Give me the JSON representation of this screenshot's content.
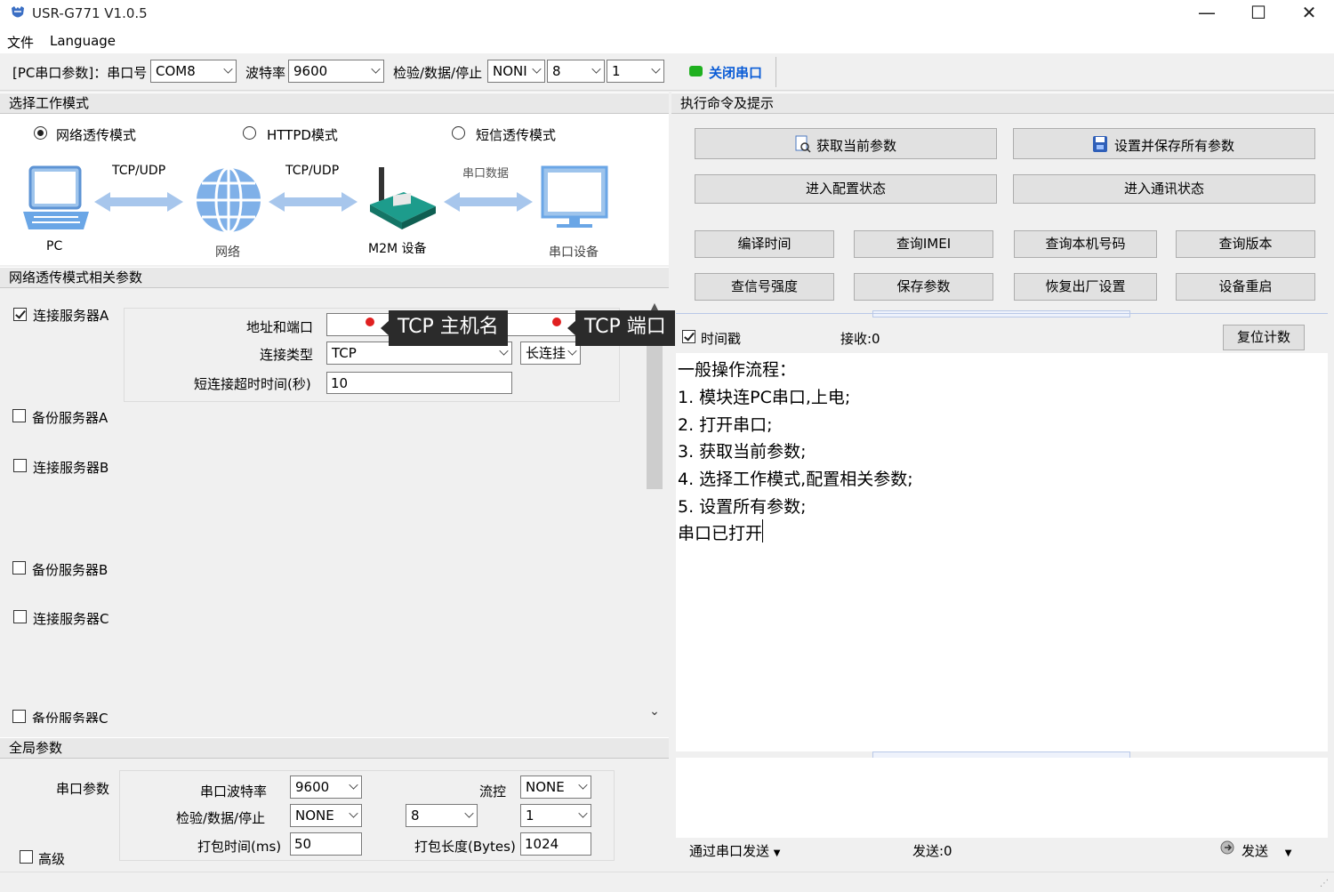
{
  "window": {
    "title": "USR-G771 V1.0.5",
    "minimize": "—",
    "maximize": "☐",
    "close": "✕"
  },
  "menu": {
    "file": "文件",
    "language": "Language"
  },
  "toolbar": {
    "pc_label": "[PC串口参数]：串口号",
    "port": "COM8",
    "baud_label": "波特率",
    "baud": "9600",
    "parity_label": "检验/数据/停止",
    "parity": "NONI",
    "databits": "8",
    "stopbits": "1",
    "close_port": "关闭串口",
    "status_color": "#1fb01f"
  },
  "mode": {
    "header": "选择工作模式",
    "options": [
      "网络透传模式",
      "HTTPD模式",
      "短信透传模式"
    ],
    "selected": "网络透传模式",
    "diagram": {
      "pc": "PC",
      "link1": "TCP/UDP",
      "network": "网络",
      "link2": "TCP/UDP",
      "m2m": "M2M 设备",
      "link3": "串口数据",
      "serial_device": "串口设备"
    }
  },
  "net_params": {
    "header": "网络透传模式相关参数",
    "serverA": {
      "label": "连接服务器A",
      "checked": true,
      "addr_label": "地址和端口",
      "addr_value": "",
      "type_label": "连接类型",
      "type": "TCP",
      "keep": "长连挂",
      "timeout_label": "短连接超时时间(秒)",
      "timeout": "10"
    },
    "servers": [
      "备份服务器A",
      "连接服务器B",
      "备份服务器B",
      "连接服务器C",
      "备份服务器C"
    ]
  },
  "tooltips": {
    "host": "TCP 主机名",
    "port": "TCP 端口"
  },
  "global": {
    "header": "全局参数",
    "serial_label": "串口参数",
    "baud_label": "串口波特率",
    "baud": "9600",
    "flow_label": "流控",
    "flow": "NONE",
    "parity_label": "检验/数据/停止",
    "parity": "NONE",
    "databits": "8",
    "stopbits": "1",
    "pack_time_label": "打包时间(ms)",
    "pack_time": "50",
    "pack_len_label": "打包长度(Bytes)",
    "pack_len": "1024",
    "advanced": "高级"
  },
  "commands": {
    "header": "执行命令及提示",
    "get_params": "获取当前参数",
    "save_all": "设置并保存所有参数",
    "enter_config": "进入配置状态",
    "enter_comm": "进入通讯状态",
    "compile_time": "编译时间",
    "query_imei": "查询IMEI",
    "query_number": "查询本机号码",
    "query_version": "查询版本",
    "query_signal": "查信号强度",
    "save_params": "保存参数",
    "factory_reset": "恢复出厂设置",
    "reboot": "设备重启"
  },
  "log": {
    "timestamp_label": "时间戳",
    "timestamp_checked": true,
    "recv": "接收:0",
    "reset_count": "复位计数",
    "lines": [
      "一般操作流程：",
      "1. 模块连PC串口,上电;",
      "2. 打开串口;",
      "3. 获取当前参数;",
      "4. 选择工作模式,配置相关参数;",
      "5. 设置所有参数;",
      "串口已打开"
    ]
  },
  "send": {
    "via": "通过串口发送",
    "sent": "发送:0",
    "send_button": "发送"
  }
}
